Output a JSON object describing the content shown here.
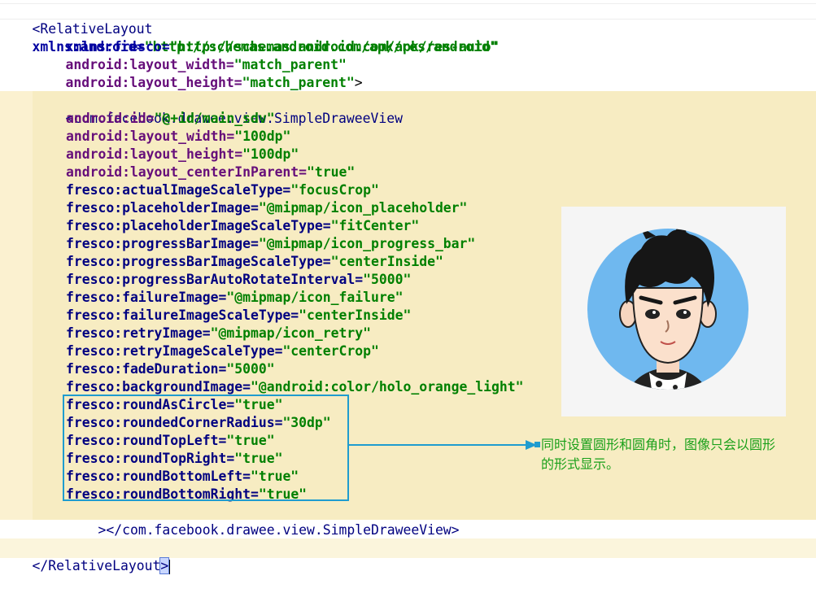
{
  "lines": [
    {
      "key": "l01"
    },
    {
      "key": "l02"
    }
  ],
  "code": {
    "rl_open": "<RelativeLayout",
    "xmlns_android_attr": "xmlns:android=",
    "xmlns_android_val": "\"http://schemas.android.com/apk/res/android\"",
    "xmlns_fresco_attr": "xmlns:fresco=",
    "xmlns_fresco_val": "\"http://schemas.android.com/apk/res-auto\"",
    "rl_width_attr": "android:layout_width=",
    "rl_width_val": "\"match_parent\"",
    "rl_height_attr": "android:layout_height=",
    "rl_height_val": "\"match_parent\"",
    "rl_close_bracket": ">",
    "sdv_open": "<com.facebook.drawee.view.SimpleDraweeView",
    "attrs": [
      {
        "ns": "android",
        "name": "android:id=",
        "value": "\"@+id/main_sdv\""
      },
      {
        "ns": "android",
        "name": "android:layout_width=",
        "value": "\"100dp\""
      },
      {
        "ns": "android",
        "name": "android:layout_height=",
        "value": "\"100dp\""
      },
      {
        "ns": "android",
        "name": "android:layout_centerInParent=",
        "value": "\"true\""
      },
      {
        "ns": "fresco",
        "name": "fresco:actualImageScaleType=",
        "value": "\"focusCrop\""
      },
      {
        "ns": "fresco",
        "name": "fresco:placeholderImage=",
        "value": "\"@mipmap/icon_placeholder\""
      },
      {
        "ns": "fresco",
        "name": "fresco:placeholderImageScaleType=",
        "value": "\"fitCenter\""
      },
      {
        "ns": "fresco",
        "name": "fresco:progressBarImage=",
        "value": "\"@mipmap/icon_progress_bar\""
      },
      {
        "ns": "fresco",
        "name": "fresco:progressBarImageScaleType=",
        "value": "\"centerInside\""
      },
      {
        "ns": "fresco",
        "name": "fresco:progressBarAutoRotateInterval=",
        "value": "\"5000\""
      },
      {
        "ns": "fresco",
        "name": "fresco:failureImage=",
        "value": "\"@mipmap/icon_failure\""
      },
      {
        "ns": "fresco",
        "name": "fresco:failureImageScaleType=",
        "value": "\"centerInside\""
      },
      {
        "ns": "fresco",
        "name": "fresco:retryImage=",
        "value": "\"@mipmap/icon_retry\""
      },
      {
        "ns": "fresco",
        "name": "fresco:retryImageScaleType=",
        "value": "\"centerCrop\""
      },
      {
        "ns": "fresco",
        "name": "fresco:fadeDuration=",
        "value": "\"5000\""
      },
      {
        "ns": "fresco",
        "name": "fresco:backgroundImage=",
        "value": "\"@android:color/holo_orange_light\""
      },
      {
        "ns": "fresco",
        "name": "fresco:roundAsCircle=",
        "value": "\"true\""
      },
      {
        "ns": "fresco",
        "name": "fresco:roundedCornerRadius=",
        "value": "\"30dp\""
      },
      {
        "ns": "fresco",
        "name": "fresco:roundTopLeft=",
        "value": "\"true\""
      },
      {
        "ns": "fresco",
        "name": "fresco:roundTopRight=",
        "value": "\"true\""
      },
      {
        "ns": "fresco",
        "name": "fresco:roundBottomLeft=",
        "value": "\"true\""
      },
      {
        "ns": "fresco",
        "name": "fresco:roundBottomRight=",
        "value": "\"true\""
      }
    ],
    "sdv_close": "></com.facebook.drawee.view.SimpleDraweeView>",
    "rl_end": "</RelativeLayout",
    "rl_end_bracket": ">"
  },
  "annotation": {
    "text_line1": "同时设置圆形和圆角时，图像只会以圆形",
    "text_line2": "的形式显示。"
  },
  "colors": {
    "highlight_bg": "#f7ecc2",
    "callout": "#1f9ccf",
    "annotation_text": "#1aa01a",
    "avatar_bg": "#6fb8ef"
  }
}
